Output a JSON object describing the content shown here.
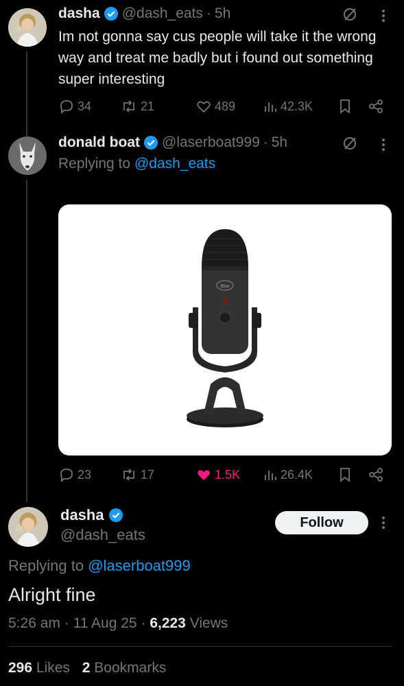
{
  "tweet1": {
    "name": "dasha",
    "handle": "@dash_eats",
    "time": "5h",
    "text": "Im not gonna say cus people will take it the wrong way and treat me badly  but i found out something super interesting",
    "replies": "34",
    "reposts": "21",
    "likes": "489",
    "views": "42.3K"
  },
  "tweet2": {
    "name": "donald boat",
    "handle": "@laserboat999",
    "time": "5h",
    "replying_label": "Replying to",
    "replying_to": "@dash_eats",
    "replies": "23",
    "reposts": "17",
    "likes": "1.5K",
    "views": "26.4K",
    "image_text": "Blue"
  },
  "main": {
    "name": "dasha",
    "handle": "@dash_eats",
    "follow_label": "Follow",
    "replying_label": "Replying to",
    "replying_to": "@laserboat999",
    "text": "Alright fine",
    "time": "5:26 am",
    "date": "11 Aug 25",
    "views_count": "6,223",
    "views_label": "Views",
    "likes_count": "296",
    "likes_label": "Likes",
    "bookmarks_count": "2",
    "bookmarks_label": "Bookmarks"
  },
  "colors": {
    "accent": "#1d9bf0",
    "like_active": "#f91880",
    "muted": "#71767b"
  },
  "icons": [
    "verified-badge-icon",
    "grok-icon",
    "more-icon",
    "reply-icon",
    "repost-icon",
    "like-icon",
    "views-icon",
    "bookmark-icon",
    "share-icon"
  ]
}
